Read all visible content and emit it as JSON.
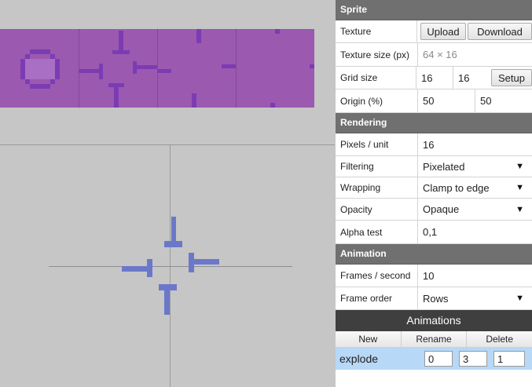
{
  "sprite": {
    "header": "Sprite",
    "texture_label": "Texture",
    "upload_label": "Upload",
    "download_label": "Download",
    "texture_size_label": "Texture size (px)",
    "texture_size_value": "64 × 16",
    "grid_size_label": "Grid size",
    "grid_w": "16",
    "grid_h": "16",
    "setup_label": "Setup",
    "origin_label": "Origin (%)",
    "origin_x": "50",
    "origin_y": "50"
  },
  "rendering": {
    "header": "Rendering",
    "ppu_label": "Pixels / unit",
    "ppu_value": "16",
    "filtering_label": "Filtering",
    "filtering_value": "Pixelated",
    "wrapping_label": "Wrapping",
    "wrapping_value": "Clamp to edge",
    "opacity_label": "Opacity",
    "opacity_value": "Opaque",
    "alpha_label": "Alpha test",
    "alpha_value": "0,1"
  },
  "animation": {
    "header": "Animation",
    "fps_label": "Frames / second",
    "fps_value": "10",
    "order_label": "Frame order",
    "order_value": "Rows"
  },
  "animations": {
    "title": "Animations",
    "new_label": "New",
    "rename_label": "Rename",
    "delete_label": "Delete",
    "items": [
      {
        "name": "explode",
        "start": "0",
        "end": "3",
        "speed": "1"
      }
    ]
  },
  "icons": {
    "dropdown": "▼"
  },
  "colors": {
    "sprite": "#9b59b0",
    "preview": "#6b78c9",
    "header": "#707070",
    "selected": "#b7d8f6"
  }
}
